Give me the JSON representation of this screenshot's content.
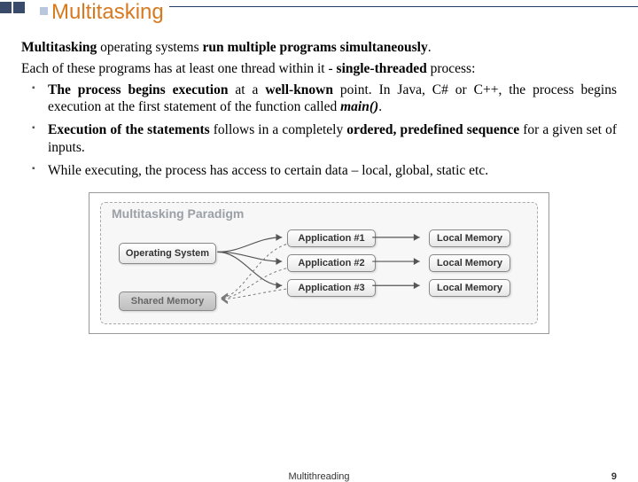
{
  "slide": {
    "title": "Multitasking",
    "intro_html": "<span class='b'>Multitasking</span> operating systems <span class='b'>run multiple programs simultaneously</span>.",
    "para2_html": "Each of these programs has at least one thread within it - <span class='b'>single-threaded</span> process:",
    "bullets": [
      "<span class='b'>The process begins execution</span> at a <span class='b'>well-known</span> point. In Java, C# or C++, the process begins execution at the first statement of the function called <span class='bi'>main()</span>.",
      "<span class='b'>Execution of the statements</span> follows in a completely <span class='b'>ordered, predefined sequence</span> for a given set of inputs.",
      "While executing, the process has access to certain data – local, global, static etc."
    ]
  },
  "diagram": {
    "title": "Multitasking Paradigm",
    "os": "Operating System",
    "apps": [
      "Application #1",
      "Application #2",
      "Application #3"
    ],
    "mem": "Local Memory",
    "shared": "Shared Memory"
  },
  "footer": {
    "center": "Multithreading",
    "page": "9"
  }
}
